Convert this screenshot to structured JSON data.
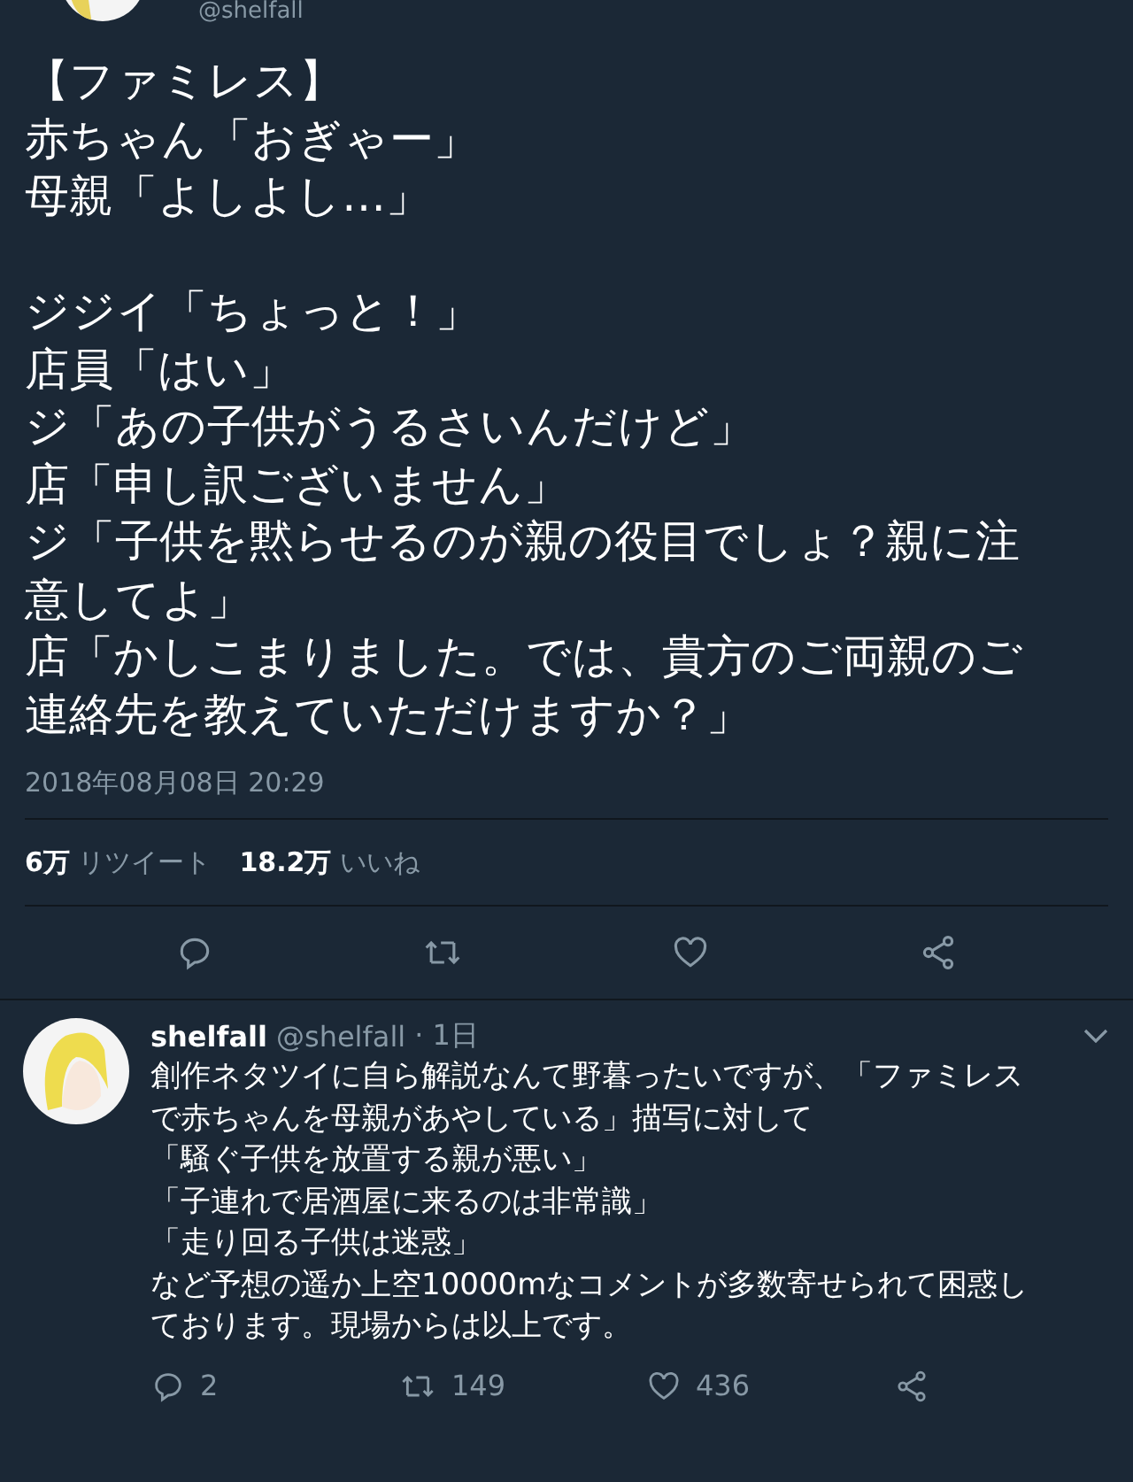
{
  "tweet": {
    "handle": "@shelfall",
    "paragraphs": [
      [
        "【ファミレス】",
        "赤ちゃん「おぎゃー」",
        "母親「よしよし…」"
      ],
      [
        "ジジイ「ちょっと！」",
        "店員「はい」",
        "ジ「あの子供がうるさいんだけど」",
        "店「申し訳ございません」",
        "ジ「子供を黙らせるのが親の役目でしょ？親に注",
        "意してよ」",
        "店「かしこまりました。では、貴方のご両親のご",
        "連絡先を教えていただけますか？」"
      ]
    ],
    "timestamp": "2018年08月08日 20:29",
    "stats": [
      {
        "count": "6万",
        "label": "リツイート"
      },
      {
        "count": "18.2万",
        "label": "いいね"
      }
    ],
    "actions": [
      {
        "kind": "reply"
      },
      {
        "kind": "retweet"
      },
      {
        "kind": "like"
      },
      {
        "kind": "share"
      }
    ]
  },
  "reply": {
    "name": "shelfall",
    "handle": "@shelfall",
    "time": "· 1日",
    "lines": [
      "創作ネタツイに自ら解説なんて野暮ったいですが、「ファミレス",
      "で赤ちゃんを母親があやしている」描写に対して",
      "「騒ぐ子供を放置する親が悪い」",
      "「子連れで居酒屋に来るのは非常識」",
      "「走り回る子供は迷惑」",
      "など予想の遥か上空10000mなコメントが多数寄せられて困惑し",
      "ております。現場からは以上です。"
    ],
    "actions": [
      {
        "kind": "reply",
        "count": "2"
      },
      {
        "kind": "retweet",
        "count": "149"
      },
      {
        "kind": "like",
        "count": "436"
      },
      {
        "kind": "share"
      }
    ]
  }
}
